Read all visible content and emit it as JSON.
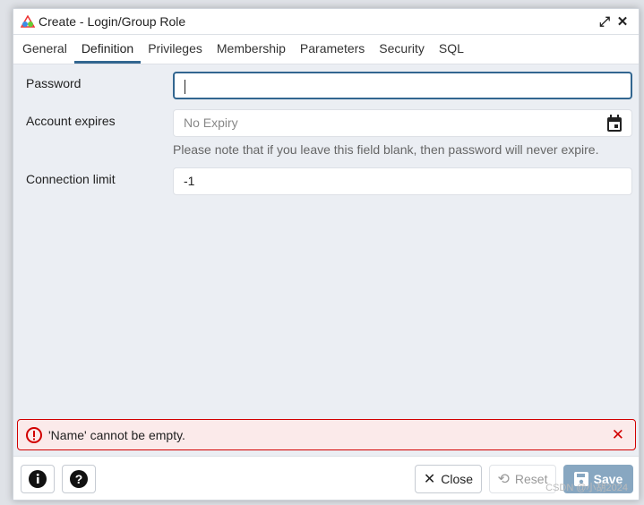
{
  "dialog": {
    "title": "Create - Login/Group Role",
    "maximize_icon": "expand-icon",
    "close_icon": "close-icon"
  },
  "tabs": [
    {
      "label": "General"
    },
    {
      "label": "Definition",
      "active": true
    },
    {
      "label": "Privileges"
    },
    {
      "label": "Membership"
    },
    {
      "label": "Parameters"
    },
    {
      "label": "Security"
    },
    {
      "label": "SQL"
    }
  ],
  "form": {
    "password_label": "Password",
    "password_value": "",
    "expires_label": "Account expires",
    "expires_placeholder": "No Expiry",
    "expires_note": "Please note that if you leave this field blank, then password will never expire.",
    "conn_label": "Connection limit",
    "conn_value": "-1"
  },
  "error": {
    "message": "'Name' cannot be empty.",
    "color": "#d20000"
  },
  "footer": {
    "close": "Close",
    "reset": "Reset",
    "save": "Save",
    "save_color": "#88a7c1"
  },
  "watermark": "CSDN @小胡2024"
}
